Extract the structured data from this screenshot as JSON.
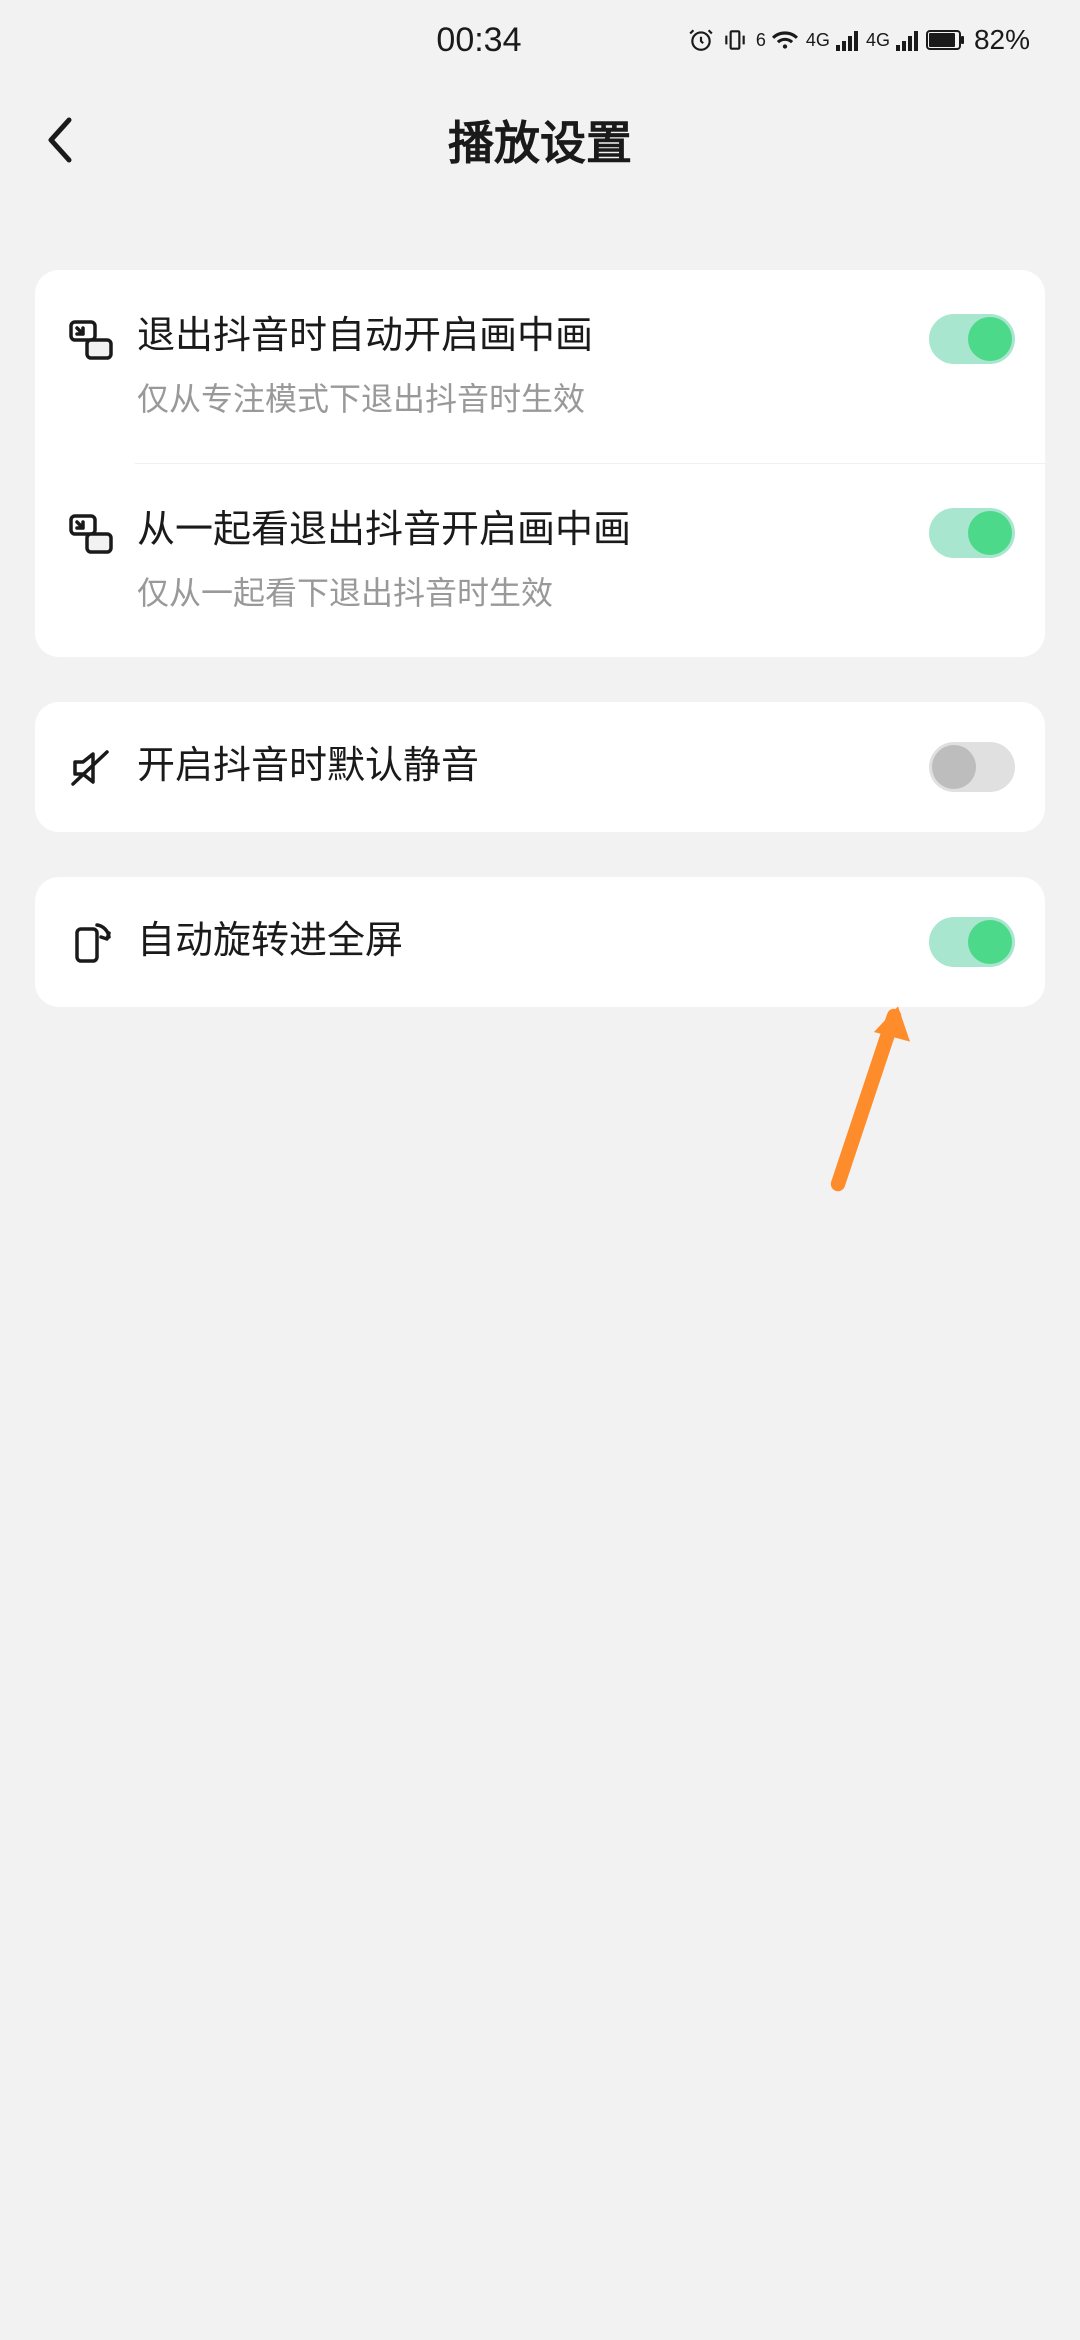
{
  "status_bar": {
    "time": "00:34",
    "battery_percent": "82%",
    "signal_label_1": "4G",
    "signal_label_2": "4G",
    "wifi_label": "6"
  },
  "header": {
    "title": "播放设置"
  },
  "settings": {
    "group1": {
      "item1": {
        "title": "退出抖音时自动开启画中画",
        "desc": "仅从专注模式下退出抖音时生效",
        "toggle_on": true
      },
      "item2": {
        "title": "从一起看退出抖音开启画中画",
        "desc": "仅从一起看下退出抖音时生效",
        "toggle_on": true
      }
    },
    "group2": {
      "item1": {
        "title": "开启抖音时默认静音",
        "toggle_on": false
      }
    },
    "group3": {
      "item1": {
        "title": "自动旋转进全屏",
        "toggle_on": true
      }
    }
  },
  "colors": {
    "toggle_on_track": "#a8e6cf",
    "toggle_on_thumb": "#4cd98a",
    "toggle_off_track": "#e0e0e0",
    "toggle_off_thumb": "#bdbdbd",
    "annotation_arrow": "#ff8c2b"
  }
}
